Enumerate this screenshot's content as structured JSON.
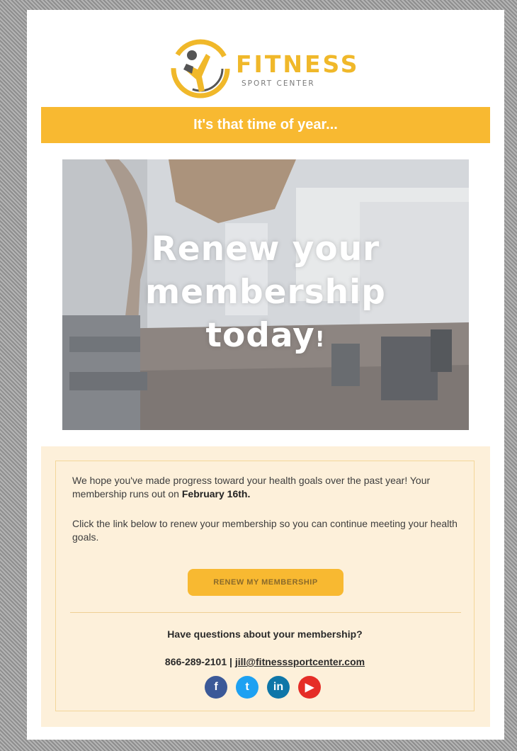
{
  "brand": {
    "name": "FITNESS",
    "tagline": "SPORT CENTER"
  },
  "banner": {
    "text": "It's that time of year..."
  },
  "hero": {
    "line1": "Renew your",
    "line2": "membership",
    "line3": "today",
    "exclaim": "!"
  },
  "body": {
    "para1_prefix": "We hope you've made progress toward your health goals over the past year! Your membership runs out on ",
    "para1_bold": "February 16th.",
    "para2": "Click the link below to renew your membership so you can continue meeting your health goals."
  },
  "cta": {
    "label": "RENEW MY MEMBERSHIP"
  },
  "footer": {
    "question": "Have questions about your membership?",
    "phone": "866-289-2101",
    "separator": " | ",
    "email": "jill@fitnesssportcenter.com"
  },
  "social": [
    {
      "name": "facebook-icon",
      "glyph": "f",
      "color": "#3b5998"
    },
    {
      "name": "twitter-icon",
      "glyph": "t",
      "color": "#1da1f2"
    },
    {
      "name": "linkedin-icon",
      "glyph": "in",
      "color": "#0e76a8"
    },
    {
      "name": "youtube-icon",
      "glyph": "▶",
      "color": "#e52d27"
    }
  ],
  "colors": {
    "accent": "#f8b931",
    "panel": "#fdf0da",
    "panel_border": "#f3d69a"
  }
}
